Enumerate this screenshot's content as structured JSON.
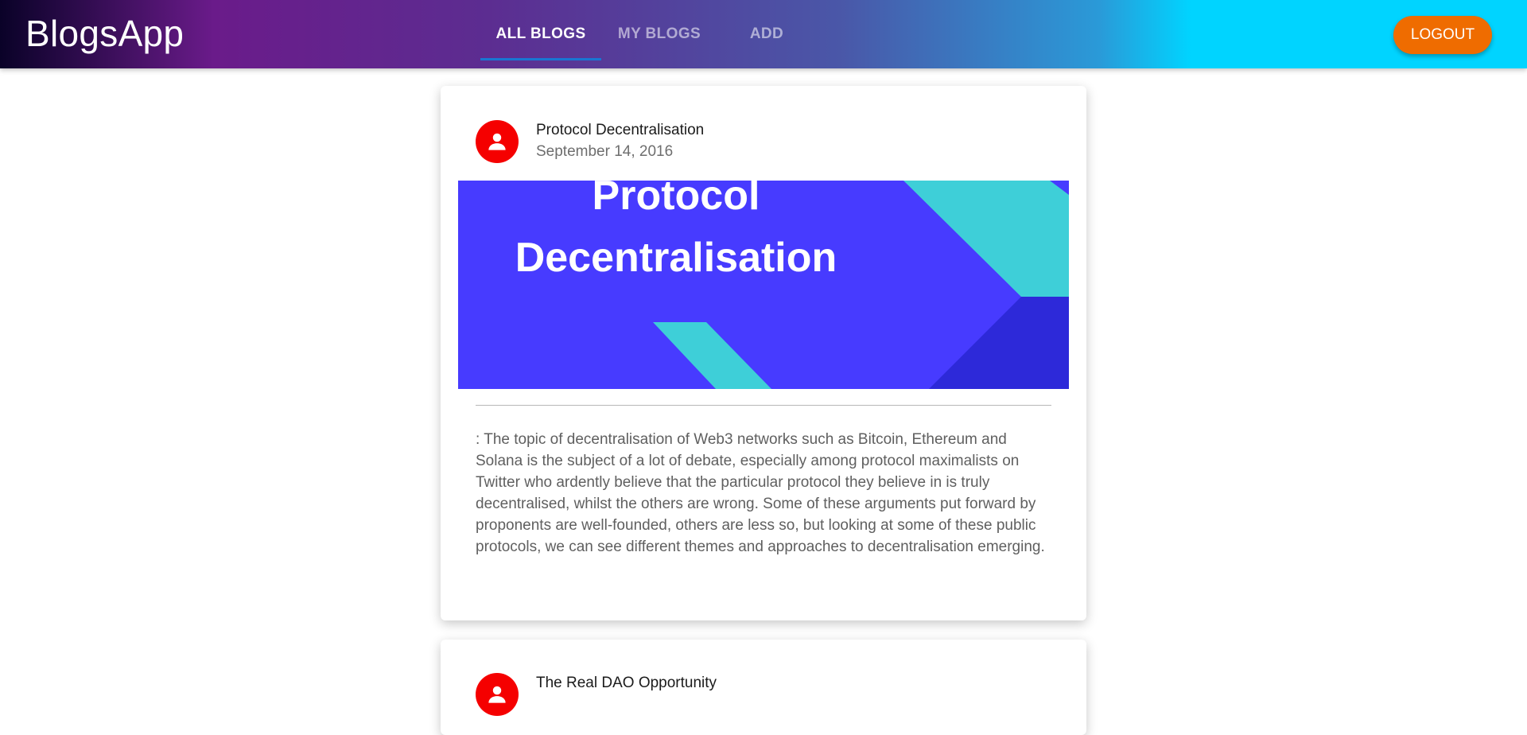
{
  "appbar": {
    "brand": "BlogsApp",
    "tabs": [
      {
        "label": "ALL BLOGS",
        "active": true
      },
      {
        "label": "MY BLOGS",
        "active": false
      },
      {
        "label": "ADD",
        "active": false
      }
    ],
    "logout_label": "LOGOUT",
    "logout_color": "#ef6c00",
    "indicator_color": "#1976d2"
  },
  "posts": [
    {
      "title": "Protocol Decentralisation",
      "date": "September 14, 2016",
      "avatar_icon": "person-icon",
      "avatar_color": "#f50000",
      "image": {
        "line1": "Protocol",
        "line2": "Decentralisation",
        "background": "#473bff",
        "accent": "#3ecfd8"
      },
      "description": ": The topic of decentralisation of Web3 networks such as Bitcoin, Ethereum and Solana is the subject of a lot of debate, especially among protocol maximalists on Twitter who ardently believe that the particular protocol they believe in is truly decentralised, whilst the others are wrong. Some of these arguments put forward by proponents are well-founded, others are less so, but looking at some of these public protocols, we can see different themes and approaches to decentralisation emerging."
    },
    {
      "title": "The Real DAO Opportunity",
      "avatar_icon": "person-icon"
    }
  ]
}
